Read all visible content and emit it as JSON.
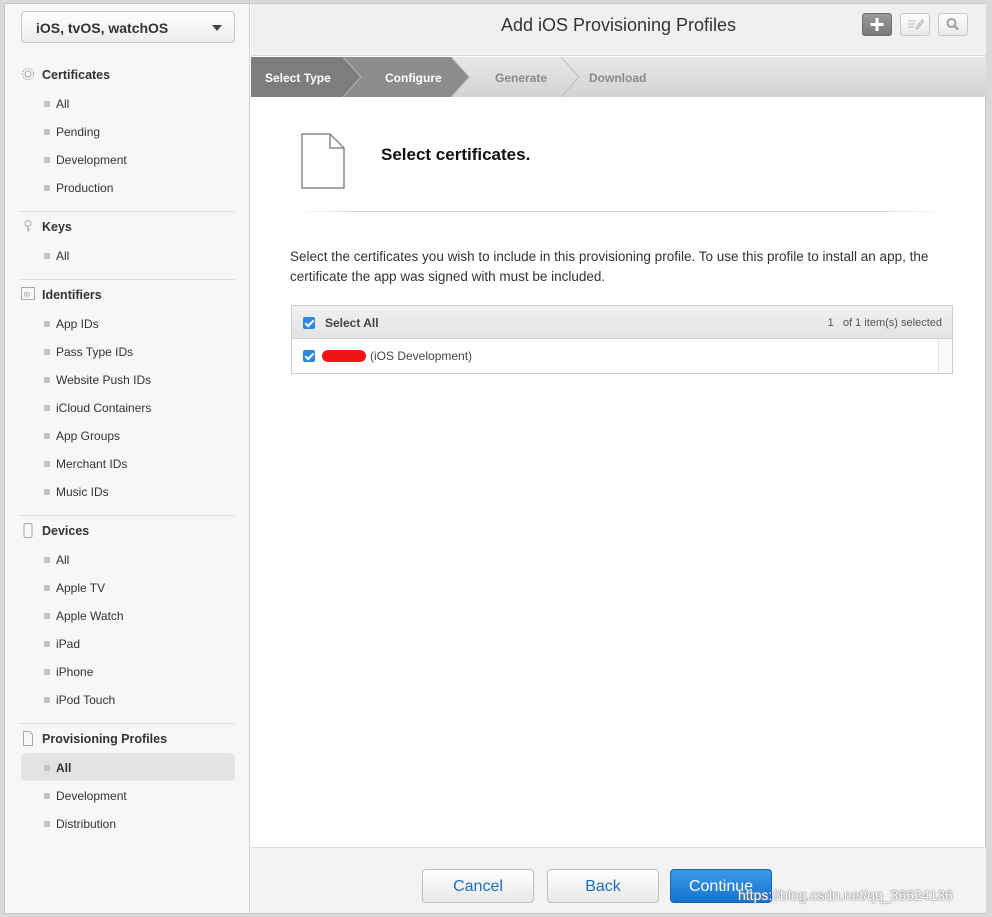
{
  "platform": "iOS, tvOS, watchOS",
  "sections": [
    {
      "title": "Certificates",
      "icon": "certificate-icon",
      "items": [
        "All",
        "Pending",
        "Development",
        "Production"
      ]
    },
    {
      "title": "Keys",
      "icon": "key-icon",
      "items": [
        "All"
      ]
    },
    {
      "title": "Identifiers",
      "icon": "id-icon",
      "items": [
        "App IDs",
        "Pass Type IDs",
        "Website Push IDs",
        "iCloud Containers",
        "App Groups",
        "Merchant IDs",
        "Music IDs"
      ]
    },
    {
      "title": "Devices",
      "icon": "device-icon",
      "items": [
        "All",
        "Apple TV",
        "Apple Watch",
        "iPad",
        "iPhone",
        "iPod Touch"
      ]
    },
    {
      "title": "Provisioning Profiles",
      "icon": "document-icon",
      "items": [
        "All",
        "Development",
        "Distribution"
      ],
      "active_item": "All"
    }
  ],
  "header": {
    "title": "Add iOS Provisioning Profiles"
  },
  "steps": [
    "Select Type",
    "Configure",
    "Generate",
    "Download"
  ],
  "content": {
    "heading": "Select certificates.",
    "description": "Select the certificates you wish to include in this provisioning profile. To use this profile to install an app, the certificate the app was signed with must be included.",
    "select_all": "Select All",
    "count_num": "1",
    "count_text": "of 1 item(s) selected",
    "certificate_type": "(iOS Development)"
  },
  "footer": {
    "cancel": "Cancel",
    "back": "Back",
    "continue": "Continue"
  },
  "watermark": "https://blog.csdn.net/qq_36624136",
  "colors": {
    "accent": "#1573d0",
    "checkbox": "#2a8ae0",
    "redaction": "#f01414"
  }
}
